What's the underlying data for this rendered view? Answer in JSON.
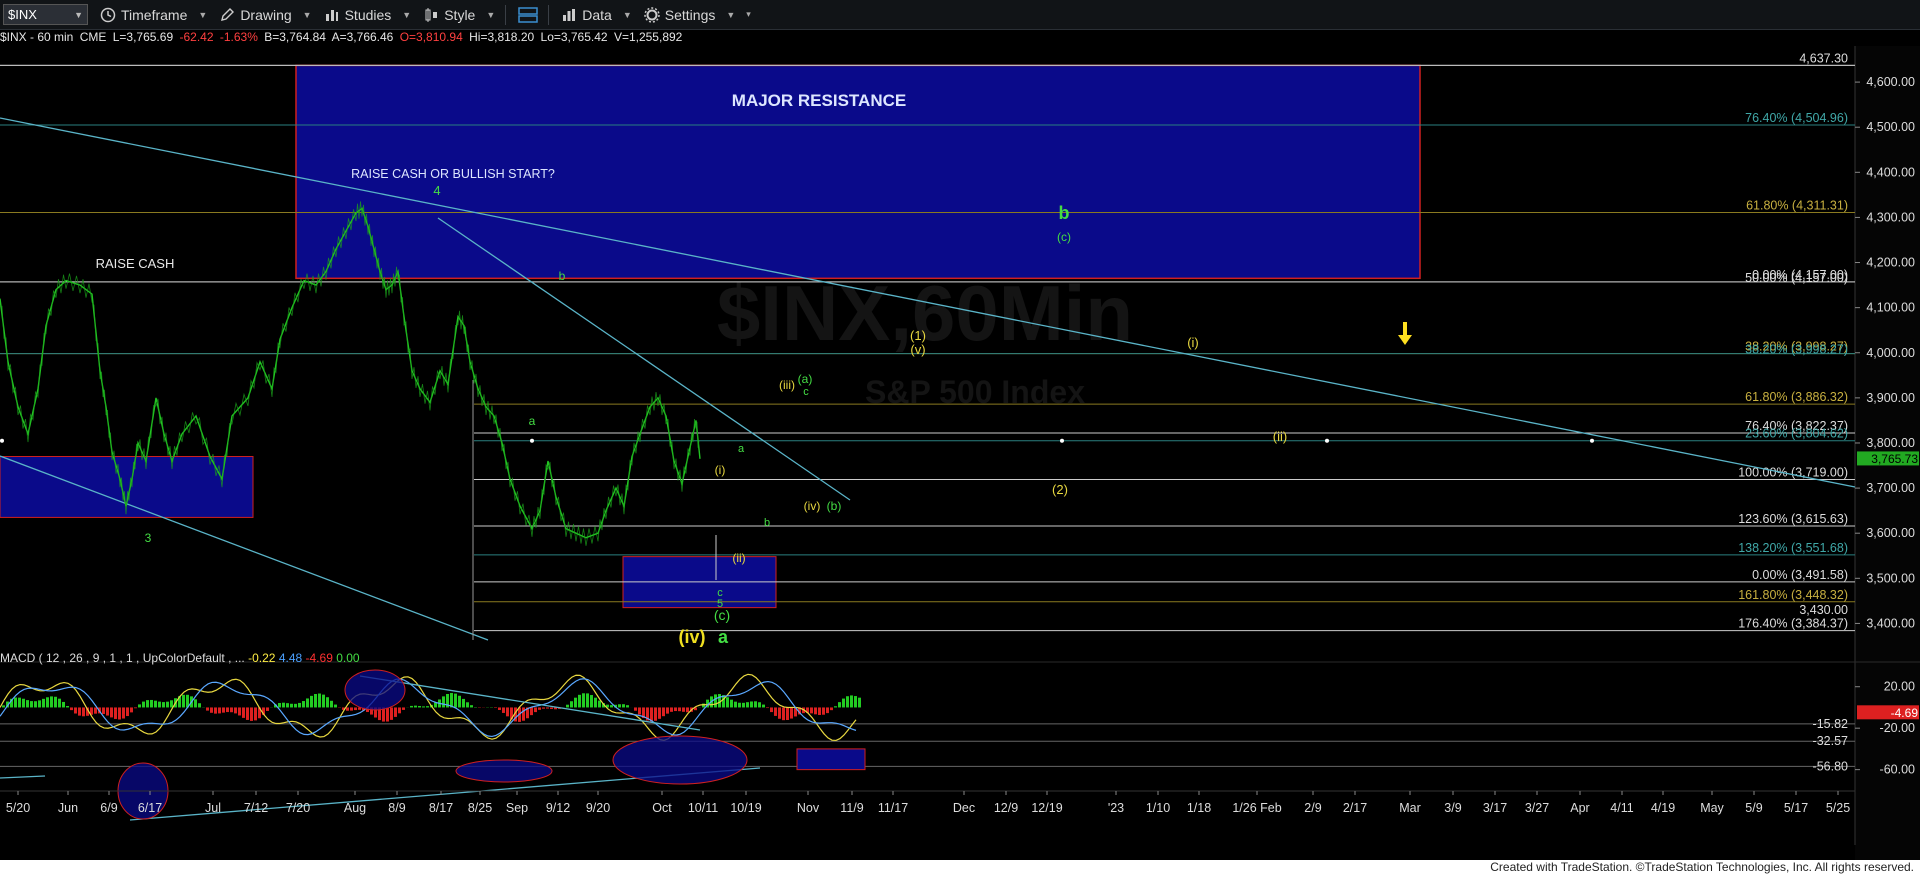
{
  "toolbar": {
    "symbol": "$INX",
    "timeframe": "Timeframe",
    "drawing": "Drawing",
    "studies": "Studies",
    "style": "Style",
    "data": "Data",
    "settings": "Settings"
  },
  "info": {
    "name": "$INX - 60 min",
    "exchange": "CME",
    "last": "L=3,765.69",
    "change": "-62.42",
    "pct": "-1.63%",
    "bar": "B=3,764.84",
    "ask": "A=3,766.46",
    "open": "O=3,810.94",
    "high": "Hi=3,818.20",
    "low": "Lo=3,765.42",
    "volume": "V=1,255,892"
  },
  "watermark": {
    "symbol": "$INX,60Min",
    "name": "S&P 500 Index"
  },
  "macd_header": {
    "label": "MACD ( 12 , 26 , 9 , 1 , 1 , UpColorDefault , ...",
    "v1": "-0.22",
    "v2": "4.48",
    "v3": "-4.69",
    "v4": "0.00"
  },
  "credit": "Created with TradeStation. ©TradeStation Technologies, Inc. All rights reserved.",
  "chart_data": {
    "type": "line",
    "title": "$INX - 60 min",
    "ylim": [
      3330,
      4680
    ],
    "y_ticks": [
      3400,
      3500,
      3600,
      3700,
      3800,
      3900,
      4000,
      4100,
      4200,
      4300,
      4400,
      4500,
      4600
    ],
    "y_tick_labels": [
      "3,400.00",
      "3,500.00",
      "3,600.00",
      "3,700.00",
      "3,800.00",
      "3,900.00",
      "4,000.00",
      "4,100.00",
      "4,200.00",
      "4,300.00",
      "4,400.00",
      "4,500.00",
      "4,600.00"
    ],
    "x_tick_labels": [
      "5/20",
      "Jun",
      "6/9",
      "6/17",
      "Jul",
      "7/12",
      "7/20",
      "Aug",
      "8/9",
      "8/17",
      "8/25",
      "Sep",
      "9/12",
      "9/20",
      "Oct",
      "10/11",
      "10/19",
      "Nov",
      "11/9",
      "11/17",
      "Dec",
      "12/9",
      "12/19",
      "'23",
      "1/10",
      "1/18",
      "1/26 Feb",
      "2/9",
      "2/17",
      "Mar",
      "3/9",
      "3/17",
      "3/27",
      "Apr",
      "4/11",
      "4/19",
      "May",
      "5/9",
      "5/17",
      "5/25"
    ],
    "last_price": "3,765.73",
    "top_level": "4,637.30",
    "bottom_level": "3,430.00",
    "fib_levels": [
      {
        "label": "76.40% (4,504.96)",
        "value": 4505,
        "color": "#2a7f7f"
      },
      {
        "label": "61.80% (4,311.31)",
        "value": 4311,
        "color": "#8a7a20"
      },
      {
        "label": "0.00% (4,157.00)",
        "value": 4157,
        "color": "#bbbbbb"
      },
      {
        "label": "50.00% (4,157.00)",
        "value": 4157,
        "color": "#bbbbbb"
      },
      {
        "label": "38.20% (3,998.27)",
        "value": 3998,
        "color": "#8a7a20"
      },
      {
        "label": "38.20% (3,998.27)",
        "value": 3998,
        "color": "#2a7f7f"
      },
      {
        "label": "61.80% (3,886.32)",
        "value": 3886,
        "color": "#8a7a20"
      },
      {
        "label": "76.40% (3,822.37)",
        "value": 3822,
        "color": "#cccccc"
      },
      {
        "label": "23.60% (3,804.62)",
        "value": 3805,
        "color": "#2a7f7f"
      },
      {
        "label": "100.00% (3,719.00)",
        "value": 3719,
        "color": "#cccccc"
      },
      {
        "label": "123.60% (3,615.63)",
        "value": 3616,
        "color": "#cccccc"
      },
      {
        "label": "138.20% (3,551.68)",
        "value": 3552,
        "color": "#2a7f7f"
      },
      {
        "label": "0.00% (3,491.58)",
        "value": 3492,
        "color": "#cccccc"
      },
      {
        "label": "161.80% (3,448.32)",
        "value": 3448,
        "color": "#8a7a20"
      },
      {
        "label": "176.40% (3,384.37)",
        "value": 3384,
        "color": "#cccccc"
      }
    ],
    "price_path": [
      [
        0,
        4120
      ],
      [
        8,
        3980
      ],
      [
        18,
        3880
      ],
      [
        28,
        3820
      ],
      [
        38,
        3920
      ],
      [
        46,
        4060
      ],
      [
        56,
        4140
      ],
      [
        66,
        4160
      ],
      [
        80,
        4150
      ],
      [
        92,
        4130
      ],
      [
        100,
        3960
      ],
      [
        106,
        3880
      ],
      [
        112,
        3780
      ],
      [
        120,
        3720
      ],
      [
        126,
        3660
      ],
      [
        132,
        3720
      ],
      [
        138,
        3800
      ],
      [
        146,
        3760
      ],
      [
        156,
        3900
      ],
      [
        164,
        3820
      ],
      [
        172,
        3760
      ],
      [
        182,
        3820
      ],
      [
        196,
        3860
      ],
      [
        210,
        3770
      ],
      [
        222,
        3720
      ],
      [
        232,
        3860
      ],
      [
        248,
        3900
      ],
      [
        260,
        3980
      ],
      [
        272,
        3920
      ],
      [
        280,
        4030
      ],
      [
        292,
        4100
      ],
      [
        304,
        4160
      ],
      [
        316,
        4150
      ],
      [
        326,
        4180
      ],
      [
        336,
        4230
      ],
      [
        346,
        4270
      ],
      [
        356,
        4310
      ],
      [
        362,
        4320
      ],
      [
        368,
        4280
      ],
      [
        374,
        4230
      ],
      [
        380,
        4180
      ],
      [
        386,
        4140
      ],
      [
        392,
        4150
      ],
      [
        398,
        4180
      ],
      [
        404,
        4080
      ],
      [
        412,
        3960
      ],
      [
        420,
        3920
      ],
      [
        430,
        3890
      ],
      [
        440,
        3960
      ],
      [
        448,
        3930
      ],
      [
        458,
        4080
      ],
      [
        464,
        4060
      ],
      [
        470,
        3980
      ],
      [
        478,
        3920
      ],
      [
        486,
        3880
      ],
      [
        494,
        3860
      ],
      [
        502,
        3800
      ],
      [
        510,
        3720
      ],
      [
        520,
        3660
      ],
      [
        532,
        3610
      ],
      [
        540,
        3650
      ],
      [
        548,
        3760
      ],
      [
        556,
        3680
      ],
      [
        566,
        3610
      ],
      [
        576,
        3600
      ],
      [
        586,
        3590
      ],
      [
        598,
        3600
      ],
      [
        606,
        3650
      ],
      [
        616,
        3700
      ],
      [
        624,
        3660
      ],
      [
        632,
        3770
      ],
      [
        640,
        3820
      ],
      [
        650,
        3880
      ],
      [
        658,
        3900
      ],
      [
        666,
        3860
      ],
      [
        674,
        3760
      ],
      [
        682,
        3710
      ],
      [
        690,
        3790
      ],
      [
        696,
        3850
      ],
      [
        700,
        3765
      ]
    ],
    "macd_ylim": [
      -70,
      40
    ],
    "macd_ticks": [
      20,
      -20,
      -60
    ],
    "macd_tick_labels": [
      "20.00",
      "-20.00",
      "-60.00"
    ],
    "macd_levels": [
      "-15.82",
      "-32.57",
      "-56.80"
    ],
    "macd_last": "-4.69"
  },
  "annotations": {
    "major_resistance": "MAJOR RESISTANCE",
    "raise_cash_bullish": "RAISE CASH OR BULLISH START?",
    "raise_cash": "RAISE CASH",
    "w4": "4",
    "w3": "3",
    "b_mid": "b",
    "a_mid": "a",
    "big_b": "b",
    "c_paren": "(c)",
    "one_v_1": "(1)",
    "one_v_2": "(v)",
    "i_right": "(i)",
    "ii_right": "(ii)",
    "two": "(2)",
    "iii": "(iii)",
    "a_paren": "(a)",
    "c_small": "c",
    "a_small": "a",
    "i_small": "(i)",
    "ii_small": "(ii)",
    "b_small": "b",
    "iv_small": "(iv)",
    "b_paren": "(b)",
    "c_bottom": "c",
    "five": "5",
    "c_green": "(c)",
    "iv_big": "(iv)",
    "a_big": "a"
  }
}
